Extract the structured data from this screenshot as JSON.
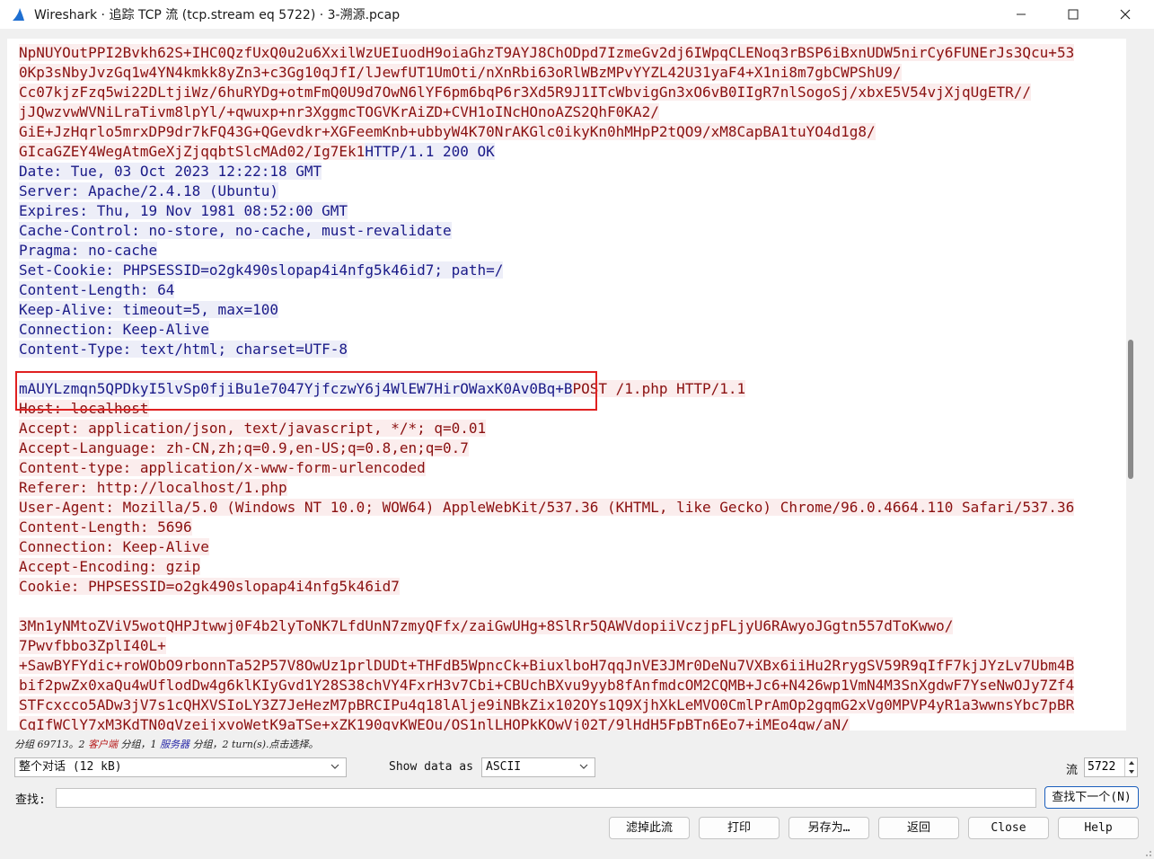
{
  "window": {
    "title": "Wireshark · 追踪 TCP 流 (tcp.stream eq 5722) · 3-溯源.pcap",
    "colors": {
      "client_bg": "#fbeded",
      "client_fg": "#8a1010",
      "server_bg": "#edeef8",
      "server_fg": "#1a1a88",
      "highlight": "#e02020"
    }
  },
  "stream": {
    "lines": [
      [
        {
          "t": "NpNUYOutPPI2Bvkh62S+IHC0QzfUxQ0u2u6XxilWzUEIuodH9oiaGhzT9AYJ8ChODpd7IzmeGv2dj6IWpqCLENoq3rBSP6iBxnUDW5nirCy6FUNErJs3Qcu+53",
          "k": "c"
        }
      ],
      [
        {
          "t": "0Kp3sNbyJvzGq1w4YN4kmkk8yZn3+c3Gg10qJfI/lJewfUT1UmOti/nXnRbi63oRlWBzMPvYYZL42U31yaF4+X1ni8m7gbCWPShU9/",
          "k": "c"
        }
      ],
      [
        {
          "t": "Cc07kjzFzq5wi22DLtjiWz/6huRYDg+otmFmQ0U9d7OwN6lYF6pm6bqP6r3Xd5R9J1ITcWbvigGn3xO6vB0IIgR7nlSogoSj/xbxE5V54vjXjqUgETR//",
          "k": "c"
        }
      ],
      [
        {
          "t": "jJQwzvwWVNiLraTivm8lpYl/+qwuxp+nr3XggmcTOGVKrAiZD+CVH1oINcHOnoAZS2QhF0KA2/",
          "k": "c"
        }
      ],
      [
        {
          "t": "GiE+JzHqrlo5mrxDP9dr7kFQ43G+QGevdkr+XGFeemKnb+ubbyW4K70NrAKGlc0ikyKn0hMHpP2tQO9/xM8CapBA1tuYO4d1g8/",
          "k": "c"
        }
      ],
      [
        {
          "t": "GIcaGZEY4WegAtmGeXjZjqqbtSlcMAd02/Ig7Ek1",
          "k": "c"
        },
        {
          "t": "HTTP/1.1 200 OK",
          "k": "s"
        }
      ],
      [
        {
          "t": "Date: Tue, 03 Oct 2023 12:22:18 GMT",
          "k": "s"
        }
      ],
      [
        {
          "t": "Server: Apache/2.4.18 (Ubuntu)",
          "k": "s"
        }
      ],
      [
        {
          "t": "Expires: Thu, 19 Nov 1981 08:52:00 GMT",
          "k": "s"
        }
      ],
      [
        {
          "t": "Cache-Control: no-store, no-cache, must-revalidate",
          "k": "s"
        }
      ],
      [
        {
          "t": "Pragma: no-cache",
          "k": "s"
        }
      ],
      [
        {
          "t": "Set-Cookie: PHPSESSID=o2gk490slopap4i4nfg5k46id7; path=/",
          "k": "s"
        }
      ],
      [
        {
          "t": "Content-Length: 64",
          "k": "s"
        }
      ],
      [
        {
          "t": "Keep-Alive: timeout=5, max=100",
          "k": "s"
        }
      ],
      [
        {
          "t": "Connection: Keep-Alive",
          "k": "s"
        }
      ],
      [
        {
          "t": "Content-Type: text/html; charset=UTF-8",
          "k": "s"
        }
      ],
      [],
      [
        {
          "t": "mAUYLzmqn5QPDkyI5lvSp0fjiBu1e7047YjfczwY6j4WlEW7HirOWaxK0Av0Bq+B",
          "k": "s"
        },
        {
          "t": "POST /1.php HTTP/1.1",
          "k": "c"
        }
      ],
      [
        {
          "t": "Host: localhost",
          "k": "c"
        }
      ],
      [
        {
          "t": "Accept: application/json, text/javascript, */*; q=0.01",
          "k": "c"
        }
      ],
      [
        {
          "t": "Accept-Language: zh-CN,zh;q=0.9,en-US;q=0.8,en;q=0.7",
          "k": "c"
        }
      ],
      [
        {
          "t": "Content-type: application/x-www-form-urlencoded",
          "k": "c"
        }
      ],
      [
        {
          "t": "Referer: http://localhost/1.php",
          "k": "c"
        }
      ],
      [
        {
          "t": "User-Agent: Mozilla/5.0 (Windows NT 10.0; WOW64) AppleWebKit/537.36 (KHTML, like Gecko) Chrome/96.0.4664.110 Safari/537.36",
          "k": "c"
        }
      ],
      [
        {
          "t": "Content-Length: 5696",
          "k": "c"
        }
      ],
      [
        {
          "t": "Connection: Keep-Alive",
          "k": "c"
        }
      ],
      [
        {
          "t": "Accept-Encoding: gzip",
          "k": "c"
        }
      ],
      [
        {
          "t": "Cookie: PHPSESSID=o2gk490slopap4i4nfg5k46id7",
          "k": "c"
        }
      ],
      [],
      [
        {
          "t": "3Mn1yNMtoZViV5wotQHPJtwwj0F4b2lyToNK7LfdUnN7zmyQFfx/zaiGwUHg+8SlRr5QAWVdopiiVczjpFLjyU6RAwyoJGgtn557dToKwwo/",
          "k": "c"
        }
      ],
      [
        {
          "t": "7Pwvfbbo3ZplI40L+",
          "k": "c"
        }
      ],
      [
        {
          "t": "+SawBYFYdic+roWObO9rbonnTa52P57V8OwUz1prlDUDt+THFdB5WpncCk+BiuxlboH7qqJnVE3JMr0DeNu7VXBx6iiHu2RrygSV59R9qIfF7kjJYzLv7Ubm4B",
          "k": "c"
        }
      ],
      [
        {
          "t": "bif2pwZx0xaQu4wUflodDw4g6klKIyGvd1Y28S38chVY4FxrH3v7Cbi+CBUchBXvu9yyb8fAnfmdcOM2CQMB+Jc6+N426wp1VmN4M3SnXgdwF7YseNwOJy7Zf4",
          "k": "c"
        }
      ],
      [
        {
          "t": "STFcxcco5ADw3jV7s1cQHXVSIoLY3Z7JeHezM7pBRCIPu4q18lAlje9iNBkZix102OYs1Q9XjhXkLeMVO0CmlPrAmOp2gqmG2xVg0MPVP4yR1a3wwnsYbc7pBR",
          "k": "c"
        }
      ],
      [
        {
          "t": "CgIfWClY7xM3KdTN0qVzeijxvoWetK9aTSe+xZK190gvKWEOu/OS1nlLHOPkKOwVj02T/9lHdH5FpBTn6Eo7+iMEo4qw/aN/",
          "k": "c"
        }
      ]
    ]
  },
  "status": {
    "prefix": "分组 69713。2 ",
    "client_label": "客户端",
    "mid1": " 分组，1 ",
    "server_label": "服务器",
    "suffix": " 分组，2 turn(s).点击选择。"
  },
  "controls": {
    "conversation_select": "整个对话 (12 kB)",
    "show_data_label": "Show data as",
    "show_data_value": "ASCII",
    "stream_label": "流",
    "stream_value": "5722",
    "find_label": "查找:",
    "find_value": "",
    "find_next": "查找下一个(N)"
  },
  "buttons": {
    "filter_out": "滤掉此流",
    "print": "打印",
    "save_as": "另存为…",
    "back": "返回",
    "close": "Close",
    "help": "Help"
  }
}
